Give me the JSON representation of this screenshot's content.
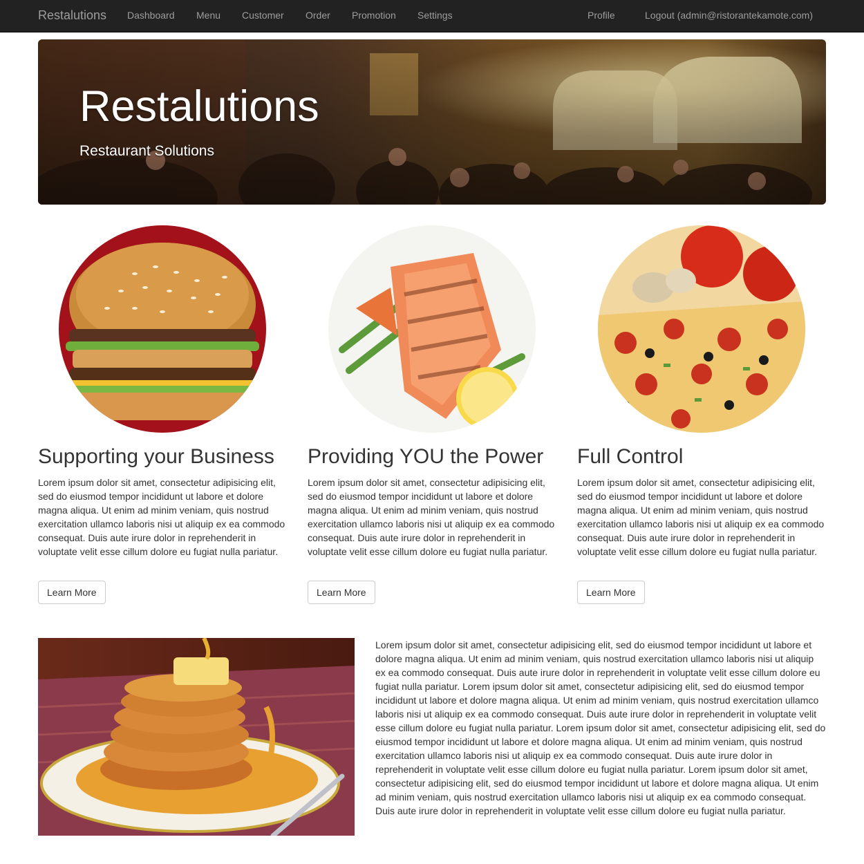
{
  "navbar": {
    "brand": "Restalutions",
    "items": [
      {
        "label": "Dashboard"
      },
      {
        "label": "Menu"
      },
      {
        "label": "Customer"
      },
      {
        "label": "Order"
      },
      {
        "label": "Promotion"
      },
      {
        "label": "Settings"
      }
    ],
    "right": [
      {
        "label": "Profile"
      },
      {
        "label": "Logout (admin@ristorantekamote.com)"
      }
    ]
  },
  "hero": {
    "title": "Restalutions",
    "subtitle": "Restaurant Solutions",
    "image": "restaurant-interior-photo"
  },
  "features": [
    {
      "image": "burger-photo",
      "heading": "Supporting your Business",
      "text": "Lorem ipsum dolor sit amet, consectetur adipisicing elit, sed do eiusmod tempor incididunt ut labore et dolore magna aliqua. Ut enim ad minim veniam, quis nostrud exercitation ullamco laboris nisi ut aliquip ex ea commodo consequat. Duis aute irure dolor in reprehenderit in voluptate velit esse cillum dolore eu fugiat nulla pariatur.",
      "button": "Learn More"
    },
    {
      "image": "salmon-photo",
      "heading": "Providing YOU the Power",
      "text": "Lorem ipsum dolor sit amet, consectetur adipisicing elit, sed do eiusmod tempor incididunt ut labore et dolore magna aliqua. Ut enim ad minim veniam, quis nostrud exercitation ullamco laboris nisi ut aliquip ex ea commodo consequat. Duis aute irure dolor in reprehenderit in voluptate velit esse cillum dolore eu fugiat nulla pariatur.",
      "button": "Learn More"
    },
    {
      "image": "pizza-photo",
      "heading": "Full Control",
      "text": "Lorem ipsum dolor sit amet, consectetur adipisicing elit, sed do eiusmod tempor incididunt ut labore et dolore magna aliqua. Ut enim ad minim veniam, quis nostrud exercitation ullamco laboris nisi ut aliquip ex ea commodo consequat. Duis aute irure dolor in reprehenderit in voluptate velit esse cillum dolore eu fugiat nulla pariatur.",
      "button": "Learn More"
    }
  ],
  "bottom": {
    "image": "pancakes-photo",
    "text": "Lorem ipsum dolor sit amet, consectetur adipisicing elit, sed do eiusmod tempor incididunt ut labore et dolore magna aliqua. Ut enim ad minim veniam, quis nostrud exercitation ullamco laboris nisi ut aliquip ex ea commodo consequat. Duis aute irure dolor in reprehenderit in voluptate velit esse cillum dolore eu fugiat nulla pariatur. Lorem ipsum dolor sit amet, consectetur adipisicing elit, sed do eiusmod tempor incididunt ut labore et dolore magna aliqua. Ut enim ad minim veniam, quis nostrud exercitation ullamco laboris nisi ut aliquip ex ea commodo consequat. Duis aute irure dolor in reprehenderit in voluptate velit esse cillum dolore eu fugiat nulla pariatur. Lorem ipsum dolor sit amet, consectetur adipisicing elit, sed do eiusmod tempor incididunt ut labore et dolore magna aliqua. Ut enim ad minim veniam, quis nostrud exercitation ullamco laboris nisi ut aliquip ex ea commodo consequat. Duis aute irure dolor in reprehenderit in voluptate velit esse cillum dolore eu fugiat nulla pariatur. Lorem ipsum dolor sit amet, consectetur adipisicing elit, sed do eiusmod tempor incididunt ut labore et dolore magna aliqua. Ut enim ad minim veniam, quis nostrud exercitation ullamco laboris nisi ut aliquip ex ea commodo consequat. Duis aute irure dolor in reprehenderit in voluptate velit esse cillum dolore eu fugiat nulla pariatur."
  },
  "colors": {
    "navbar_bg": "#222222",
    "navbar_text": "#9d9d9d",
    "body_text": "#333333",
    "button_border": "#cccccc"
  }
}
